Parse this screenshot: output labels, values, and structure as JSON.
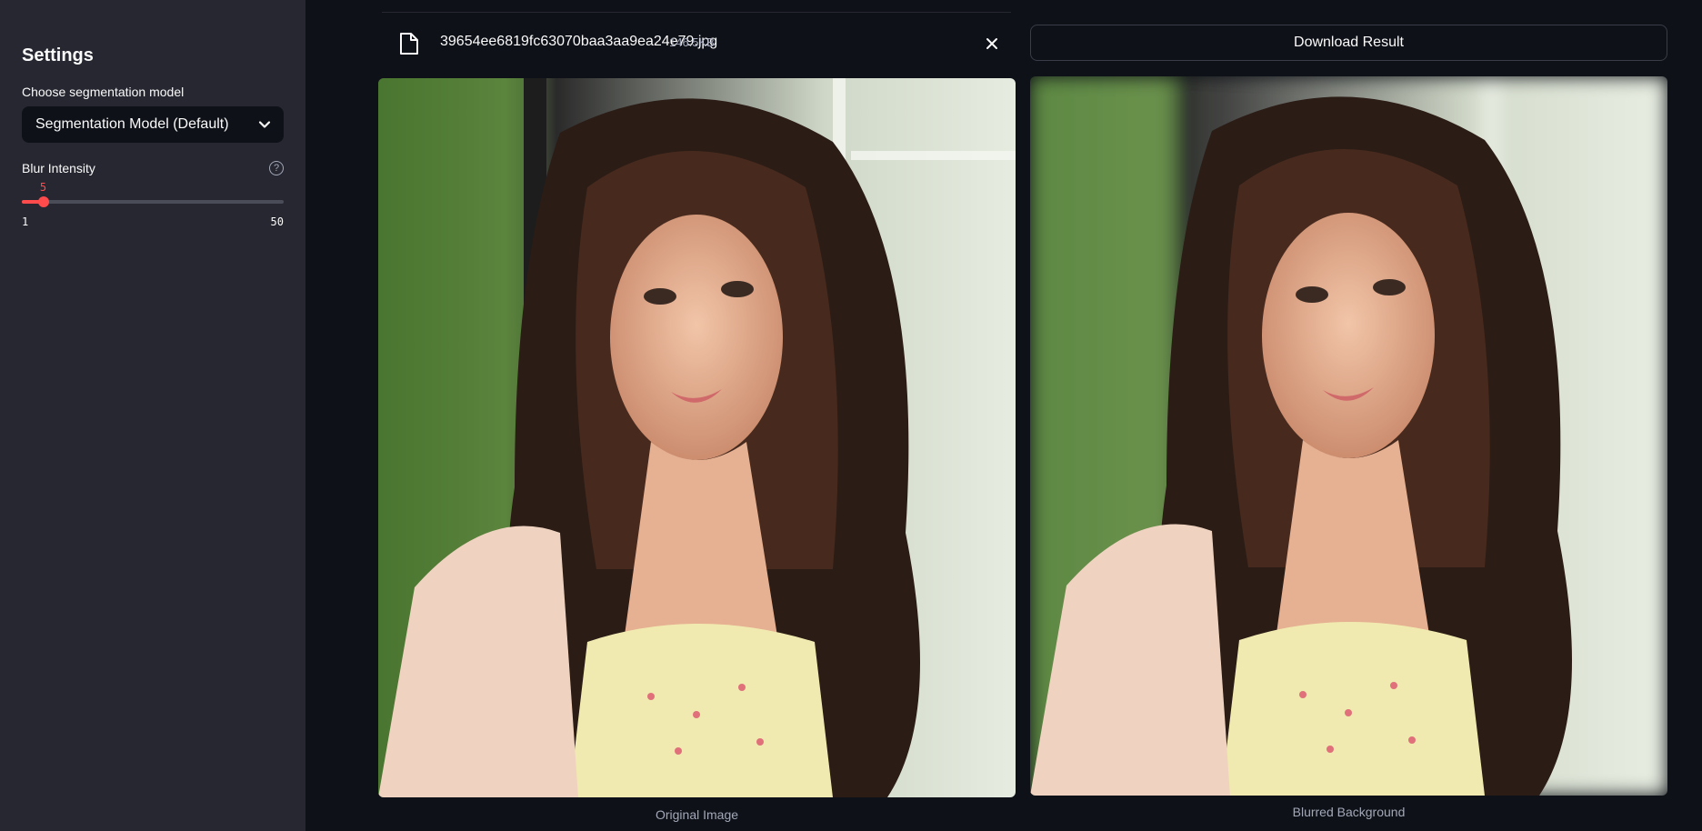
{
  "sidebar": {
    "title": "Settings",
    "model_label": "Choose segmentation model",
    "model_selected": "Segmentation Model (Default)",
    "blur_label": "Blur Intensity",
    "blur_value": "5",
    "blur_min": "1",
    "blur_max": "50",
    "blur_fraction": 0.0816,
    "accent_color": "#ff4b4b"
  },
  "uploader": {
    "file_name": "39654ee6819fc63070baa3aa9ea24e79.jpg",
    "file_size": "146.5KB"
  },
  "download": {
    "label": "Download Result"
  },
  "images": {
    "original_caption": "Original Image",
    "result_caption": "Blurred Background"
  }
}
